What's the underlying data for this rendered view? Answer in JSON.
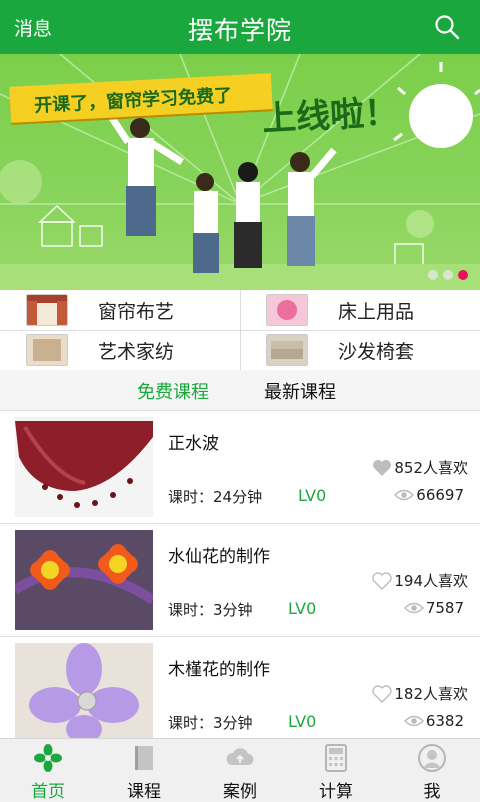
{
  "header": {
    "messages_label": "消息",
    "title": "摆布学院"
  },
  "banner": {
    "ribbon_text": "开课了，窗帘学习免费了",
    "headline": "上线啦！",
    "slide_count": 3,
    "active_slide": 3
  },
  "categories": [
    {
      "label": "窗帘布艺",
      "icon": "curtain-thumb"
    },
    {
      "label": "床上用品",
      "icon": "bedding-thumb"
    },
    {
      "label": "艺术家纺",
      "icon": "textile-thumb"
    },
    {
      "label": "沙发椅套",
      "icon": "sofa-thumb"
    }
  ],
  "tabs": {
    "free": "免费课程",
    "latest": "最新课程",
    "active": "free"
  },
  "courses": [
    {
      "name": "正水波",
      "likes": "852人喜欢",
      "liked": true,
      "duration": "课时：24分钟",
      "level": "LV0",
      "views": "66697"
    },
    {
      "name": "水仙花的制作",
      "likes": "194人喜欢",
      "liked": false,
      "duration": "课时：3分钟",
      "level": "LV0",
      "views": "7587"
    },
    {
      "name": "木槿花的制作",
      "likes": "182人喜欢",
      "liked": false,
      "duration": "课时：3分钟",
      "level": "LV0",
      "views": "6382"
    }
  ],
  "nav": [
    {
      "label": "首页",
      "icon": "home-icon",
      "active": true
    },
    {
      "label": "课程",
      "icon": "book-icon",
      "active": false
    },
    {
      "label": "案例",
      "icon": "cloud-icon",
      "active": false
    },
    {
      "label": "计算",
      "icon": "calculator-icon",
      "active": false
    },
    {
      "label": "我",
      "icon": "profile-icon",
      "active": false
    }
  ],
  "colors": {
    "brand_green": "#1aa83e",
    "banner_green": "#86d35a",
    "ribbon_yellow": "#f5cf21",
    "active_dot": "#e8125a"
  }
}
